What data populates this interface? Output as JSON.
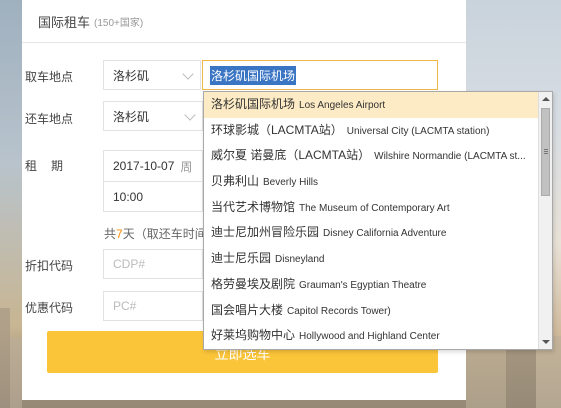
{
  "header": {
    "title": "国际租车",
    "subtitle": "(150+国家)"
  },
  "labels": {
    "pickup": "取车地点",
    "return": "还车地点",
    "rent_period": "租　期",
    "discount_code": "折扣代码",
    "promo_code": "优惠代码"
  },
  "pickup": {
    "city": "洛杉矶",
    "location": "洛杉矶国际机场"
  },
  "return": {
    "city": "洛杉矶"
  },
  "rent": {
    "date": "2017-10-07",
    "weekday_partial": "周",
    "time": "10:00"
  },
  "days_summary": {
    "prefix": "共",
    "count": "7",
    "suffix": "天（取还车时间"
  },
  "discount_code": {
    "placeholder": "CDP#"
  },
  "promo_code": {
    "placeholder": "PC#"
  },
  "submit": {
    "label": "立即选车"
  },
  "colors": {
    "accent": "#fbc53a",
    "highlight": "#fcebc4",
    "selection": "#3a75c4",
    "focus_border": "#f0b64a"
  },
  "suggestions": [
    {
      "cn": "洛杉矶国际机场",
      "en": "Los Angeles Airport"
    },
    {
      "cn": "环球影城（LACMTA站）",
      "en": "Universal City (LACMTA station)"
    },
    {
      "cn": "威尔夏 诺曼底（LACMTA站）",
      "en": "Wilshire Normandie (LACMTA st..."
    },
    {
      "cn": "贝弗利山",
      "en": "Beverly Hills"
    },
    {
      "cn": "当代艺术博物馆",
      "en": "The Museum of Contemporary Art"
    },
    {
      "cn": "迪士尼加州冒险乐园",
      "en": "Disney California Adventure"
    },
    {
      "cn": "迪士尼乐园",
      "en": "Disneyland"
    },
    {
      "cn": "格劳曼埃及剧院",
      "en": "Grauman's Egyptian Theatre"
    },
    {
      "cn": "国会唱片大楼",
      "en": "Capitol Records Tower)"
    },
    {
      "cn": "好莱坞购物中心",
      "en": "Hollywood and Highland Center"
    }
  ]
}
